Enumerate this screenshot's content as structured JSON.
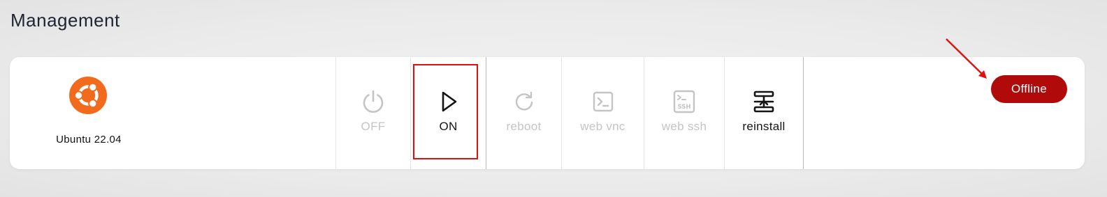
{
  "page": {
    "title": "Management"
  },
  "os": {
    "name": "Ubuntu 22.04",
    "icon": "ubuntu-logo-icon",
    "color": "#f26a1b"
  },
  "actions": [
    {
      "label": "OFF",
      "icon": "power-icon",
      "enabled": false
    },
    {
      "label": "ON",
      "icon": "play-icon",
      "enabled": true
    },
    {
      "label": "reboot",
      "icon": "refresh-icon",
      "enabled": false
    },
    {
      "label": "web vnc",
      "icon": "terminal-icon",
      "enabled": false
    },
    {
      "label": "web ssh",
      "icon": "ssh-icon",
      "enabled": false,
      "icon_text": "SSH"
    },
    {
      "label": "reinstall",
      "icon": "reinstall-icon",
      "enabled": true
    }
  ],
  "status": {
    "label": "Offline",
    "color": "#b10a0a"
  },
  "annotation": {
    "highlight_color": "#e01010"
  }
}
